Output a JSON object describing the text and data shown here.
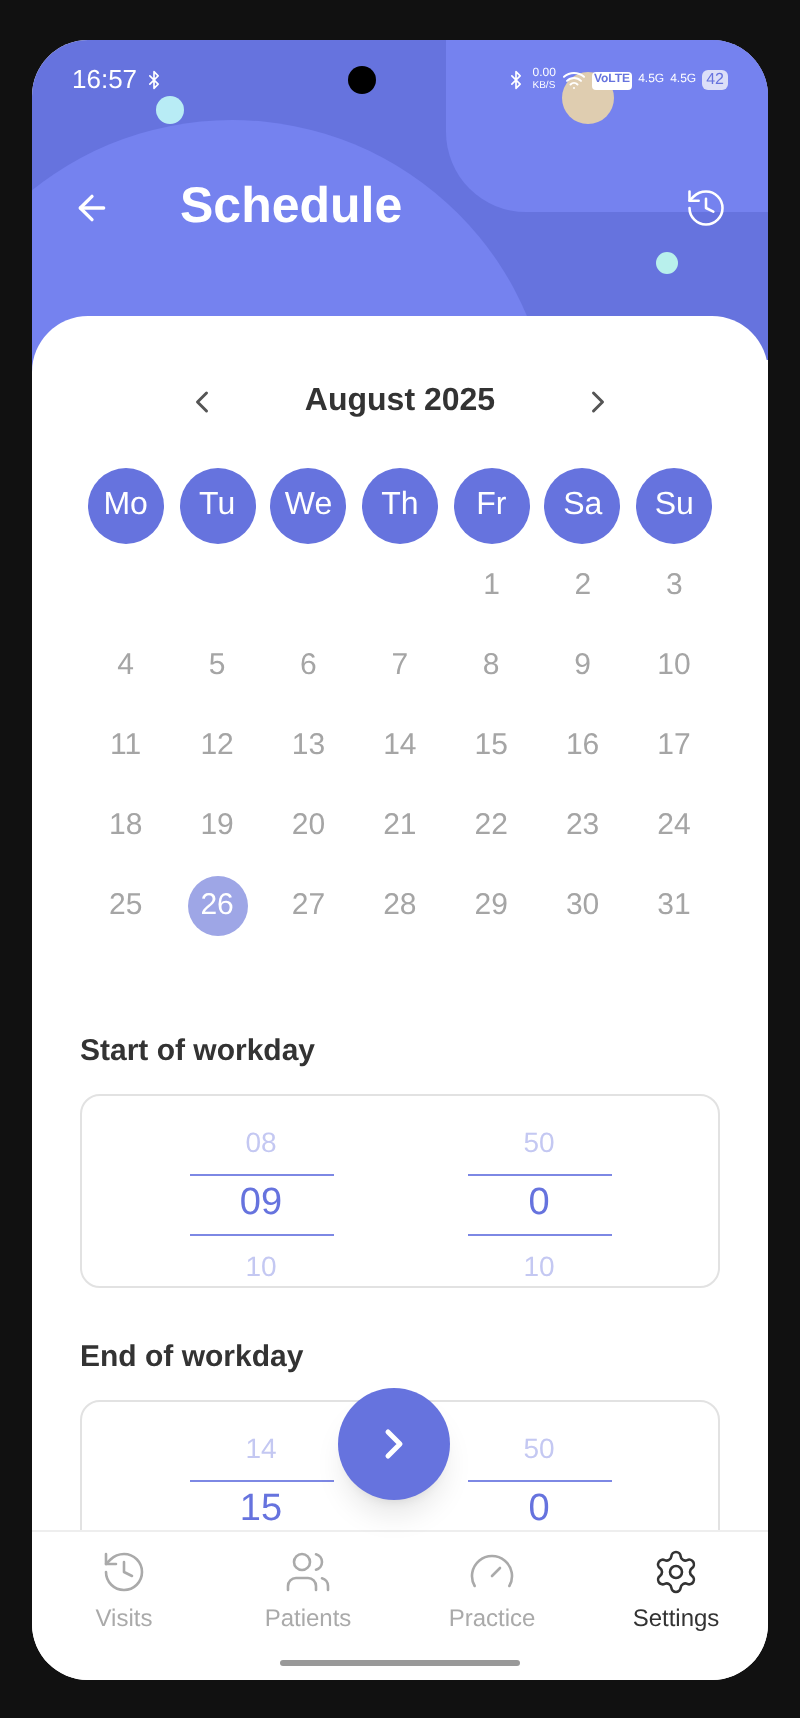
{
  "status_bar": {
    "time": "16:57",
    "speed_value": "0.00",
    "speed_unit": "KB/S",
    "volte": "VoLTE",
    "networks": [
      "4.5G",
      "4.5G"
    ],
    "battery": "42"
  },
  "header": {
    "title": "Schedule"
  },
  "calendar": {
    "month": "August 2025",
    "weekdays": [
      "Mo",
      "Tu",
      "We",
      "Th",
      "Fr",
      "Sa",
      "Su"
    ],
    "weeks": [
      [
        {
          "label": "1",
          "selected": false
        },
        {
          "label": "2",
          "selected": false
        },
        {
          "label": "3",
          "selected": false
        }
      ],
      [
        {
          "label": "4",
          "selected": false
        },
        {
          "label": "5",
          "selected": false
        },
        {
          "label": "6",
          "selected": false
        },
        {
          "label": "7",
          "selected": false
        },
        {
          "label": "8",
          "selected": false
        },
        {
          "label": "9",
          "selected": false
        },
        {
          "label": "10",
          "selected": false
        }
      ],
      [
        {
          "label": "11",
          "selected": false
        },
        {
          "label": "12",
          "selected": false
        },
        {
          "label": "13",
          "selected": false
        },
        {
          "label": "14",
          "selected": false
        },
        {
          "label": "15",
          "selected": false
        },
        {
          "label": "16",
          "selected": false
        },
        {
          "label": "17",
          "selected": false
        }
      ],
      [
        {
          "label": "18",
          "selected": false
        },
        {
          "label": "19",
          "selected": false
        },
        {
          "label": "20",
          "selected": false
        },
        {
          "label": "21",
          "selected": false
        },
        {
          "label": "22",
          "selected": false
        },
        {
          "label": "23",
          "selected": false
        },
        {
          "label": "24",
          "selected": false
        }
      ],
      [
        {
          "label": "25",
          "selected": false
        },
        {
          "label": "26",
          "selected": true
        },
        {
          "label": "27",
          "selected": false
        },
        {
          "label": "28",
          "selected": false
        },
        {
          "label": "29",
          "selected": false
        },
        {
          "label": "30",
          "selected": false
        },
        {
          "label": "31",
          "selected": false
        }
      ]
    ]
  },
  "pickers": [
    {
      "label": "Start of workday",
      "columns": [
        {
          "items": [
            {
              "text": "08",
              "selected": false
            },
            {
              "text": "09",
              "selected": true
            },
            {
              "text": "10",
              "selected": false
            }
          ]
        },
        {
          "items": [
            {
              "text": "50",
              "selected": false
            },
            {
              "text": "0",
              "selected": true
            },
            {
              "text": "10",
              "selected": false
            }
          ]
        }
      ]
    },
    {
      "label": "End of workday",
      "columns": [
        {
          "items": [
            {
              "text": "14",
              "selected": false
            },
            {
              "text": "15",
              "selected": true
            }
          ]
        },
        {
          "items": [
            {
              "text": "50",
              "selected": false
            },
            {
              "text": "0",
              "selected": true
            }
          ]
        }
      ]
    }
  ],
  "nav": [
    {
      "label": "Visits",
      "kind": "visits",
      "selected": false
    },
    {
      "label": "Patients",
      "kind": "patients",
      "selected": false
    },
    {
      "label": "Practice",
      "kind": "practice",
      "selected": false
    },
    {
      "label": "Settings",
      "kind": "settings",
      "selected": true
    }
  ]
}
